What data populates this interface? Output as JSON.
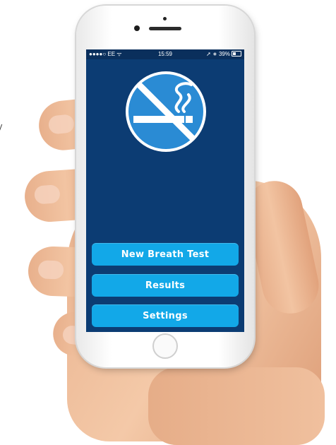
{
  "status_bar": {
    "carrier": "●●●●○ EE ᯤ",
    "time": "15:59",
    "right": "➚ ∗ 39%"
  },
  "main": {
    "logo_icon": "no-smoking-icon",
    "buttons": {
      "new_test": "New Breath Test",
      "results": "Results",
      "settings": "Settings"
    }
  },
  "colors": {
    "screen_bg": "#0c3c73",
    "button_bg": "#12a8e8",
    "logo_bg": "#2a8bd4"
  }
}
